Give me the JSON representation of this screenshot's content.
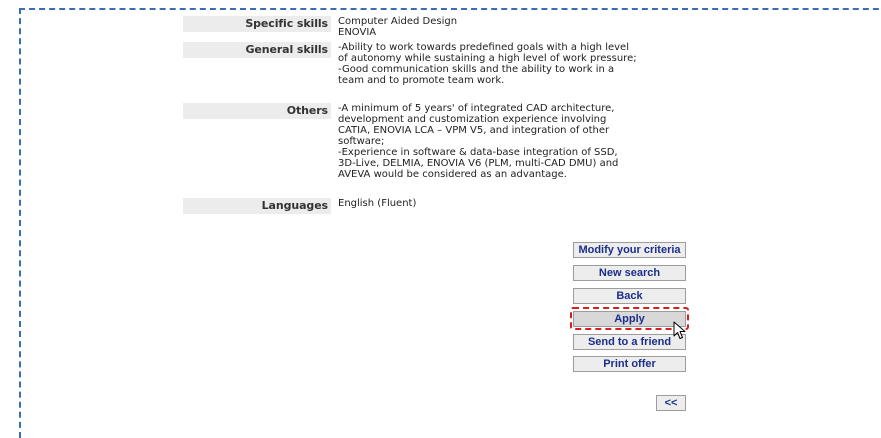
{
  "details": [
    {
      "label": "Specific skills",
      "value": "Computer Aided Design\nENOVIA"
    },
    {
      "label": "General skills",
      "value": "-Ability to work towards predefined goals with a high level\nof autonomy while sustaining a high level of work pressure;\n-Good communication skills and the ability to work in a\nteam and to promote team work."
    },
    {
      "label": "Others",
      "value": "-A minimum of 5 years' of integrated CAD architecture,\ndevelopment and customization experience involving\nCATIA, ENOVIA LCA – VPM V5, and integration of other\nsoftware;\n-Experience in software & data-base integration of SSD,\n3D-Live, DELMIA, ENOVIA V6 (PLM, multi-CAD DMU) and\nAVEVA would be considered as an advantage."
    },
    {
      "label": "Languages",
      "value": "English (Fluent)"
    }
  ],
  "actions": {
    "modify": "Modify your criteria",
    "new_search": "New search",
    "back": "Back",
    "apply": "Apply",
    "send": "Send to a friend",
    "print": "Print offer",
    "prev": "<<"
  },
  "colors": {
    "frame_border": "#3a6db5",
    "highlight": "#d81e1e",
    "button_text": "#1b2f8a"
  }
}
